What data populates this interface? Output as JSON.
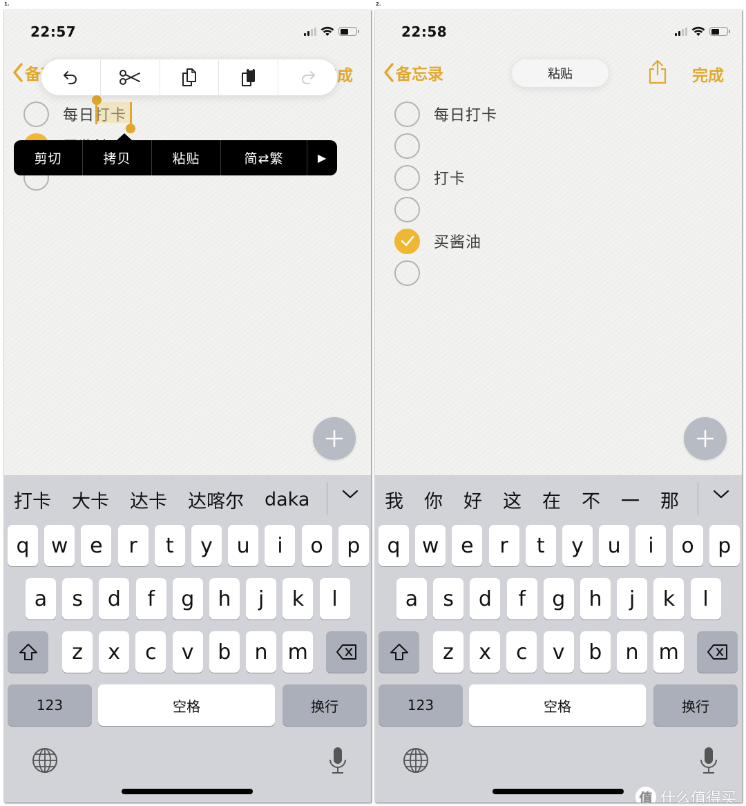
{
  "accent_color": "#e1a82d",
  "panels": [
    {
      "number": "1.",
      "status": {
        "time": "22:57"
      },
      "nav": {
        "back_label": "备忘录",
        "done_label": "完成"
      },
      "edit_toolbar": {
        "items": [
          {
            "icon": "undo-icon"
          },
          {
            "icon": "scissors-icon"
          },
          {
            "icon": "copy-icon"
          },
          {
            "icon": "paste-icon"
          },
          {
            "icon": "redo-icon",
            "disabled": true
          }
        ]
      },
      "checklist": [
        {
          "text": "每日打卡",
          "checked": false,
          "selected_text": "打卡"
        },
        {
          "text": "买酱油",
          "checked": true
        },
        {
          "text": "",
          "checked": false
        }
      ],
      "context_menu": {
        "items": [
          "剪切",
          "拷贝",
          "粘贴",
          "简⇄繁"
        ],
        "more": "▶"
      },
      "candidates": [
        "打卡",
        "大卡",
        "达卡",
        "达喀尔",
        "daka"
      ]
    },
    {
      "number": "2.",
      "status": {
        "time": "22:58"
      },
      "nav": {
        "back_label": "备忘录",
        "done_label": "完成"
      },
      "paste_pill": "粘贴",
      "checklist": [
        {
          "text": "每日打卡",
          "checked": false
        },
        {
          "text": "",
          "checked": false
        },
        {
          "text": "打卡",
          "checked": false
        },
        {
          "text": "",
          "checked": false
        },
        {
          "text": "买酱油",
          "checked": true
        },
        {
          "text": "",
          "checked": false
        }
      ],
      "candidates": [
        "我",
        "你",
        "好",
        "这",
        "在",
        "不",
        "一",
        "那"
      ]
    }
  ],
  "keyboard": {
    "row1": [
      "q",
      "w",
      "e",
      "r",
      "t",
      "y",
      "u",
      "i",
      "o",
      "p"
    ],
    "row2": [
      "a",
      "s",
      "d",
      "f",
      "g",
      "h",
      "j",
      "k",
      "l"
    ],
    "row3": [
      "z",
      "x",
      "c",
      "v",
      "b",
      "n",
      "m"
    ],
    "numbers_label": "123",
    "space_label": "空格",
    "return_label": "换行"
  },
  "watermark": {
    "badge": "值",
    "text": "什么值得买"
  }
}
